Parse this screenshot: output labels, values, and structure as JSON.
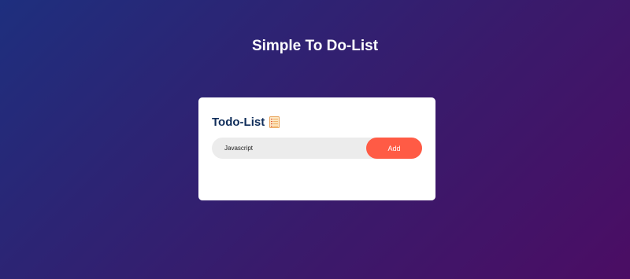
{
  "page": {
    "title": "Simple To Do-List"
  },
  "todo_card": {
    "title": "Todo-List",
    "icon": "notepad-icon",
    "input": {
      "value": "Javascript",
      "placeholder": ""
    },
    "add_button_label": "Add"
  },
  "colors": {
    "background_start": "#1e2f7e",
    "background_end": "#4b0d64",
    "card_title": "#0f2d5a",
    "add_button": "#ff5b45",
    "input_background": "#ececec"
  }
}
